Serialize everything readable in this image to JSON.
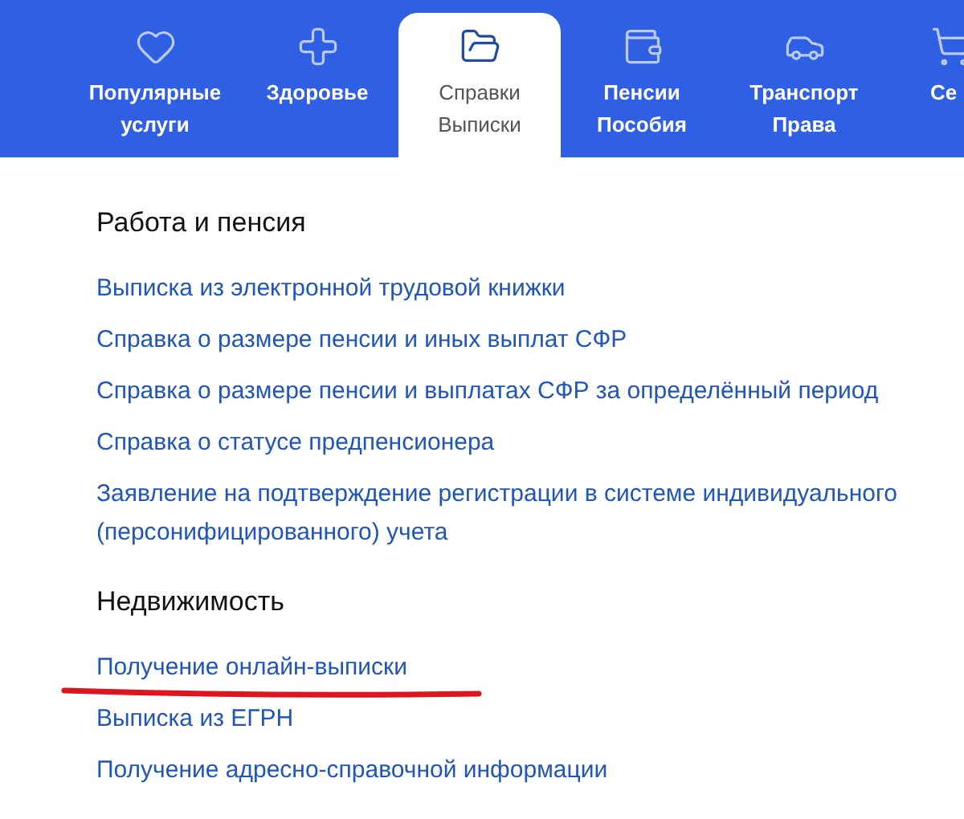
{
  "tabs": [
    {
      "label": "Популярные услуги",
      "selected": false
    },
    {
      "label": "Здоровье",
      "selected": false
    },
    {
      "label": "Справки Выписки",
      "selected": true
    },
    {
      "label": "Пенсии Пособия",
      "selected": false
    },
    {
      "label": "Транспорт Права",
      "selected": false
    },
    {
      "label": "Се",
      "selected": false
    }
  ],
  "sections": [
    {
      "title": "Работа и пенсия",
      "links": [
        {
          "text": "Выписка из электронной трудовой книжки",
          "underlined": false
        },
        {
          "text": "Справка о размере пенсии и иных выплат СФР",
          "underlined": false
        },
        {
          "text": "Справка о размере пенсии и выплатах СФР за определённый период",
          "underlined": false
        },
        {
          "text": "Справка о статусе предпенсионера",
          "underlined": false
        },
        {
          "text": "Заявление на подтверждение регистрации в системе индивидуального (персонифицированного) учета",
          "underlined": false
        }
      ]
    },
    {
      "title": "Недвижимость",
      "links": [
        {
          "text": "Получение онлайн-выписки",
          "underlined": true
        },
        {
          "text": "Выписка из ЕГРН",
          "underlined": false
        },
        {
          "text": "Получение адресно-справочной информации",
          "underlined": false
        }
      ]
    }
  ]
}
